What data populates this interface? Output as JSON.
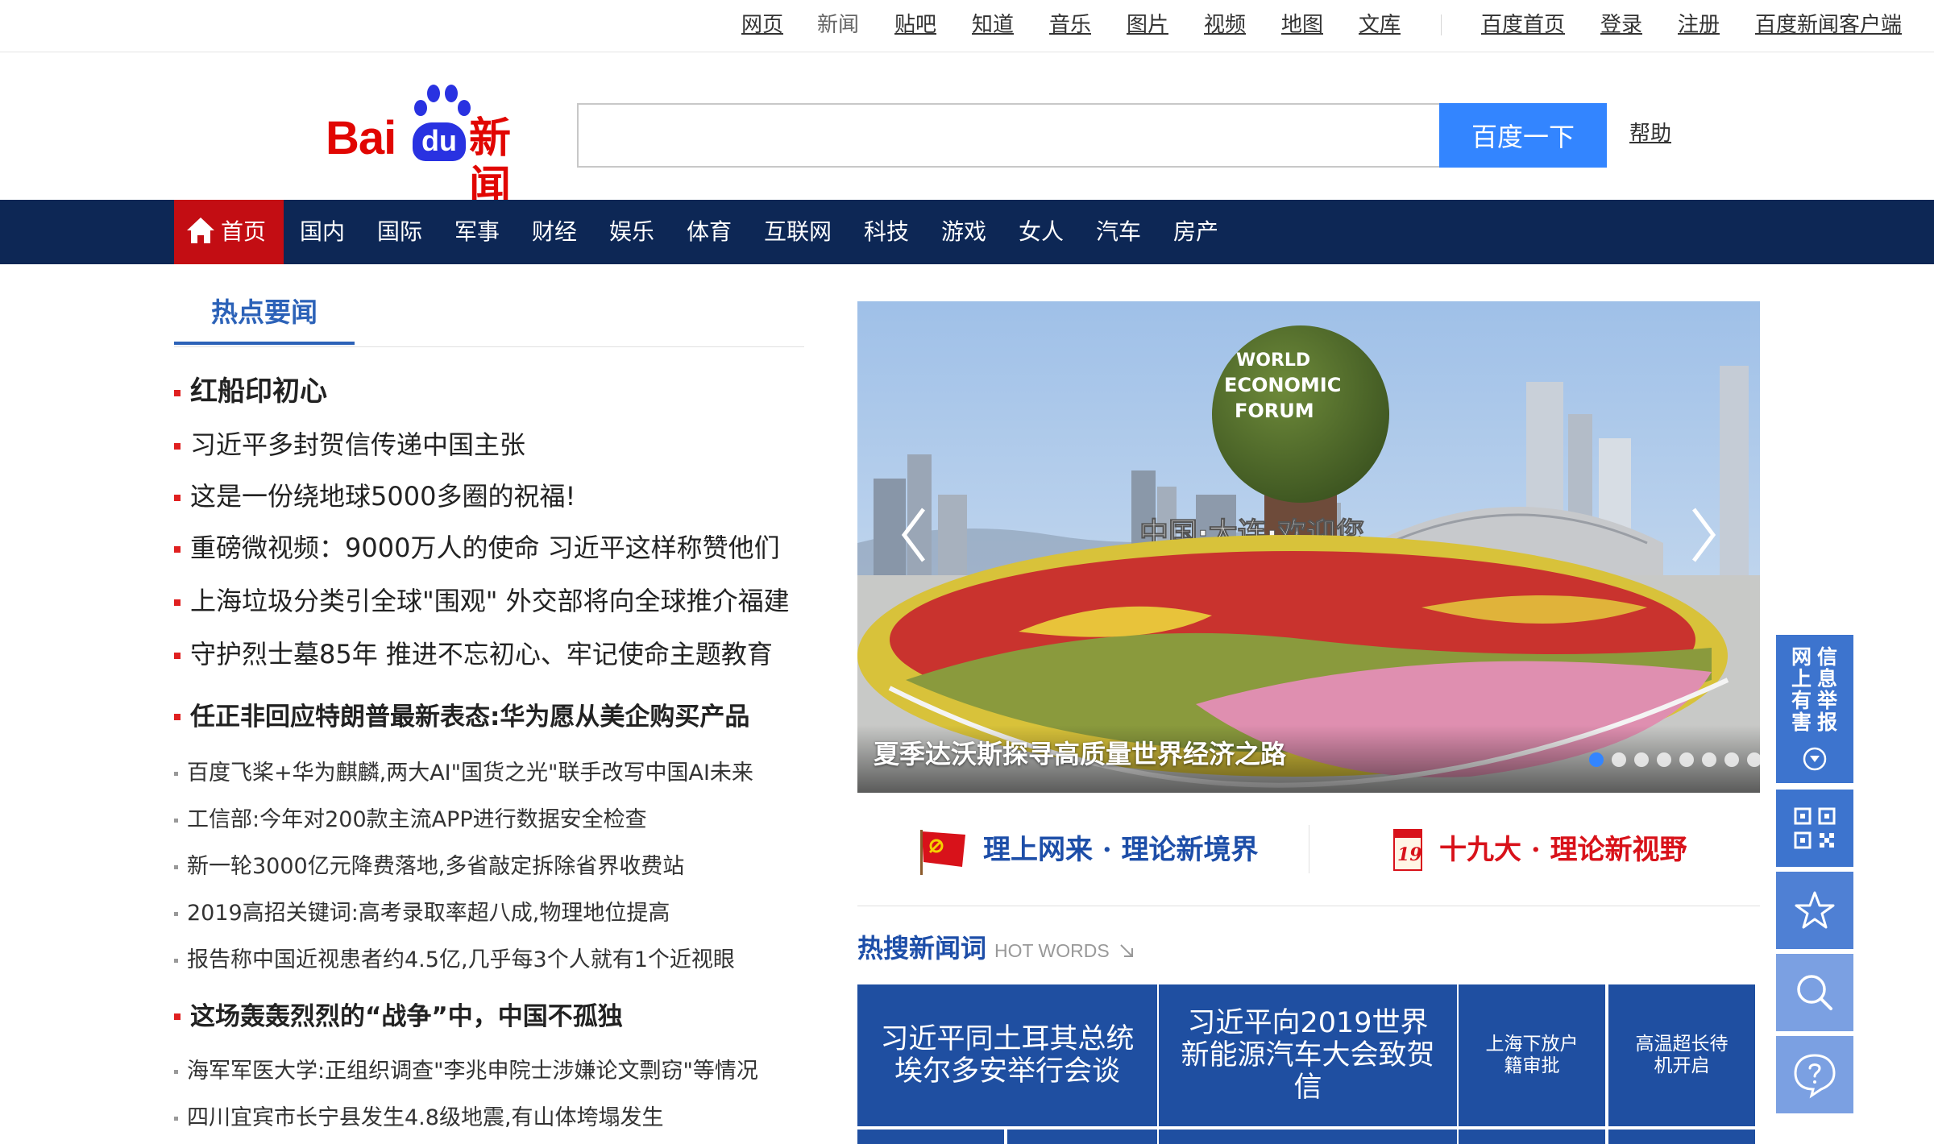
{
  "topnav": {
    "links": [
      "网页",
      "新闻",
      "贴吧",
      "知道",
      "音乐",
      "图片",
      "视频",
      "地图",
      "文库"
    ],
    "right_links": [
      "百度首页",
      "登录",
      "注册",
      "百度新闻客户端"
    ]
  },
  "header": {
    "logo_text_left": "Bai",
    "logo_text_badge": "du",
    "logo_text_right": "新闻",
    "search_value": "",
    "search_button": "百度一下",
    "help_link": "帮助"
  },
  "mainnav": {
    "home": "首页",
    "items": [
      "国内",
      "国际",
      "军事",
      "财经",
      "娱乐",
      "体育",
      "互联网",
      "科技",
      "游戏",
      "女人",
      "汽车",
      "房产"
    ]
  },
  "hot": {
    "tab": "热点要闻",
    "headlines": [
      "红船印初心",
      "习近平多封贺信传递中国主张",
      "这是一份绕地球5000多圈的祝福!",
      "重磅微视频：9000万人的使命  习近平这样称赞他们",
      "上海垃圾分类引全球\"围观\" 外交部将向全球推介福建",
      "守护烈士墓85年  推进不忘初心、牢记使命主题教育"
    ],
    "group1_title": "任正非回应特朗普最新表态:华为愿从美企购买产品",
    "group1_items": [
      "百度飞桨+华为麒麟,两大AI\"国货之光\"联手改写中国AI未来",
      "工信部:今年对200款主流APP进行数据安全检查",
      "新一轮3000亿元降费落地,多省敲定拆除省界收费站",
      "2019高招关键词:高考录取率超八成,物理地位提高",
      "报告称中国近视患者约4.5亿,几乎每3个人就有1个近视眼"
    ],
    "group2_title": "这场轰轰烈烈的“战争”中，中国不孤独",
    "group2_items": [
      "海军军医大学:正组织调查\"李兆申院士涉嫌论文剽窃\"等情况",
      "四川宜宾市长宁县发生4.8级地震,有山体垮塌发生"
    ]
  },
  "carousel": {
    "caption": "夏季达沃斯探寻高质量世界经济之路",
    "sign_text": "中国·大连·欢迎您",
    "globe_text": [
      "WORLD",
      "ECONOMIC",
      "FORUM"
    ],
    "slide_count": 8,
    "active_index": 0
  },
  "banners": {
    "left": "理上网来 · 理论新境界",
    "right": "十九大 · 理论新视野",
    "badge_number": "19"
  },
  "hotwords": {
    "title": "热搜新闻词",
    "subtitle": "HOT WORDS",
    "tiles": [
      "习近平同土耳其总统埃尔多安举行会谈",
      "习近平向2019世界新能源汽车大会致贺信",
      "上海下放户籍审批",
      "高温超长待机开启"
    ]
  },
  "sidebar": {
    "report_label": "网信上有害报息举",
    "report_cols": [
      "网上有害",
      "信息举报"
    ]
  },
  "colors": {
    "brand_red": "#e10602",
    "brand_blue": "#2932e1",
    "search_blue": "#3385ff",
    "nav_bg": "#0d2755",
    "nav_active": "#c30d13",
    "tile_blue": "#1f4fa1"
  }
}
